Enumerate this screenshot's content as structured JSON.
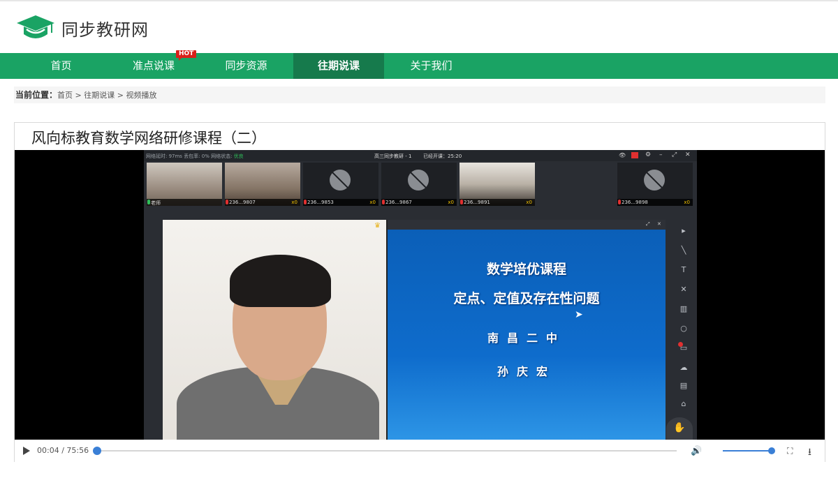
{
  "site": {
    "name": "同步教研网"
  },
  "nav": {
    "items": [
      {
        "label": "首页"
      },
      {
        "label": "准点说课"
      },
      {
        "label": "同步资源"
      },
      {
        "label": "往期说课"
      },
      {
        "label": "关于我们"
      }
    ],
    "hot_badge": "HOT",
    "active_index": 3
  },
  "breadcrumb": {
    "prefix": "当前位置：",
    "items": [
      "首页",
      "往期说课",
      "视频播放"
    ],
    "separator": " > "
  },
  "course": {
    "title": "风向标教育数学网络研修课程（二）"
  },
  "meeting": {
    "status_left": "网络延时: 97ms 丢包率: 0% 网络状态: ",
    "status_good": "优良",
    "room_title": "高三同步教研 - 1",
    "elapsed_label": "已经开课：25:20",
    "participants": [
      {
        "id": "老师",
        "cup": ""
      },
      {
        "id": "236...9807",
        "cup": "x0"
      },
      {
        "id": "236...9853",
        "cup": "x0"
      },
      {
        "id": "236...9867",
        "cup": "x0"
      },
      {
        "id": "236...9891",
        "cup": "x0"
      },
      {
        "id": "236...9898",
        "cup": "x0"
      }
    ],
    "slide": {
      "line1": "数学培优课程",
      "line2": "定点、定值及存在性问题",
      "line3": "南昌二中",
      "line4": "孙庆宏"
    }
  },
  "player": {
    "current_time": "00:04",
    "duration": "75:56",
    "time_sep": " / ",
    "progress_fraction": 0.0,
    "volume_fraction": 1.0
  },
  "colors": {
    "nav_green": "#1aa364",
    "nav_active": "#167a4c",
    "accent_blue": "#3a7fd6"
  }
}
